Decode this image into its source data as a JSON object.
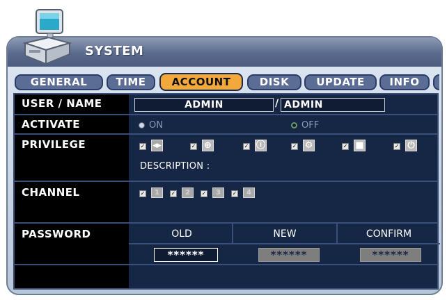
{
  "window": {
    "title": "SYSTEM",
    "icon": "computer-icon"
  },
  "tabs": [
    {
      "label": "GENERAL",
      "active": false
    },
    {
      "label": "TIME",
      "active": false
    },
    {
      "label": "ACCOUNT",
      "active": true
    },
    {
      "label": "DISK",
      "active": false
    },
    {
      "label": "UPDATE",
      "active": false
    },
    {
      "label": "INFO",
      "active": false
    },
    {
      "label": "M",
      "active": false
    }
  ],
  "user": {
    "label": "USER / NAME",
    "user_value": "ADMIN",
    "separator": "/",
    "name_value": "ADMIN"
  },
  "activate": {
    "label": "ACTIVATE",
    "on_label": "ON",
    "off_label": "OFF",
    "selected": "ON"
  },
  "privilege": {
    "label": "PRIVILEGE",
    "icons": [
      "ptz-icon",
      "plus-circle-icon",
      "info-icon",
      "gear-icon",
      "stop-icon",
      "power-icon"
    ],
    "description_label": "DESCRIPTION :"
  },
  "channel": {
    "label": "CHANNEL",
    "numbers": [
      "1",
      "2",
      "3",
      "4"
    ]
  },
  "password": {
    "label": "PASSWORD",
    "old_label": "OLD",
    "new_label": "NEW",
    "confirm_label": "CONFIRM",
    "old_value": "******",
    "new_value": "******",
    "confirm_value": "******"
  },
  "colors": {
    "active_tab": "#f2a83a",
    "panel_bg": "#162645",
    "label_bg": "#000000"
  }
}
